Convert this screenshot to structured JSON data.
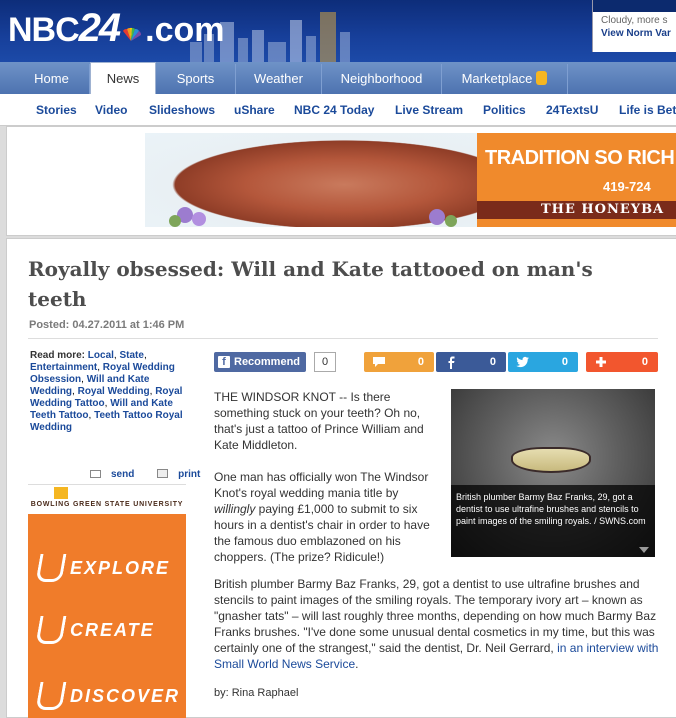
{
  "header": {
    "logo_nbc": "NBC",
    "logo_num": "24",
    "logo_domain": ".com",
    "weather_top": "",
    "weather_condition": "Cloudy, more s",
    "weather_link": "View Norm Var"
  },
  "nav": {
    "tabs": [
      {
        "label": "Home",
        "active": false
      },
      {
        "label": "News",
        "active": true
      },
      {
        "label": "Sports",
        "active": false
      },
      {
        "label": "Weather",
        "active": false
      },
      {
        "label": "Neighborhood",
        "active": false
      },
      {
        "label": "Marketplace",
        "active": false
      }
    ],
    "sub": [
      "Stories",
      "Video",
      "Slideshows",
      "uShare",
      "NBC 24 Today",
      "Live Stream",
      "Politics",
      "24TextsU",
      "Life is Bet"
    ]
  },
  "ad": {
    "headline": "TRADITION SO RICH",
    "phone": "419-724",
    "brand": "THE HONEYBA",
    "brand_prefix": "THE"
  },
  "article": {
    "title": "Royally obsessed: Will and Kate tattooed on man's teeth",
    "posted": "Posted: 04.27.2011 at 1:46 PM",
    "read_more_label": "Read more:",
    "tags": [
      "Local",
      "State",
      "Entertainment",
      "Royal Wedding Obsession",
      "Will and Kate Wedding",
      "Royal Wedding",
      "Royal Wedding Tattoo",
      "Will and Kate Teeth Tattoo",
      "Teeth Tattoo Royal Wedding"
    ],
    "send": "send",
    "print": "print",
    "lead_p1": "THE WINDSOR KNOT -- Is there something stuck on your teeth? Oh no, that's just a tattoo of Prince William and Kate Middleton.",
    "lead_p2_a": "One man has officially won The Windsor Knot's royal wedding mania title by ",
    "lead_p2_em": "willingly",
    "lead_p2_b": " paying £1,000 to submit to six hours in a dentist's chair in order to have the famous duo emblazoned on his choppers. (The prize? Ridicule!)",
    "photo_caption": "British plumber Barmy Baz Franks, 29, got a dentist to use ultrafine brushes and stencils to paint images of the smiling royals.  / SWNS.com",
    "body_text": "British plumber Barmy Baz Franks, 29, got a dentist to use ultrafine brushes and stencils to paint images of the smiling royals. The temporary ivory art – known as \"gnasher tats\" – will last roughly three months, depending on how much Barmy Baz Franks brushes. \"I've done some unusual dental cosmetics in my time, but this was certainly one of the strangest,\" said the dentist, Dr. Neil Gerrard, ",
    "body_link": "in an interview with Small World News Service",
    "body_end": ".",
    "byline": "by: Rina Raphael"
  },
  "share": {
    "recommend_label": "Recommend",
    "recommend_count": "0",
    "comments_count": "0",
    "facebook_count": "0",
    "twitter_count": "0",
    "plus_count": "0",
    "colors": {
      "comments": "#f0a23b",
      "facebook": "#3b5a98",
      "twitter": "#2aa6e0",
      "plus": "#f2562e"
    }
  },
  "sidebar_ad": {
    "logo_text": "BOWLING GREEN STATE UNIVERSITY",
    "words": [
      "EXPLORE",
      "CREATE",
      "DISCOVER"
    ]
  }
}
